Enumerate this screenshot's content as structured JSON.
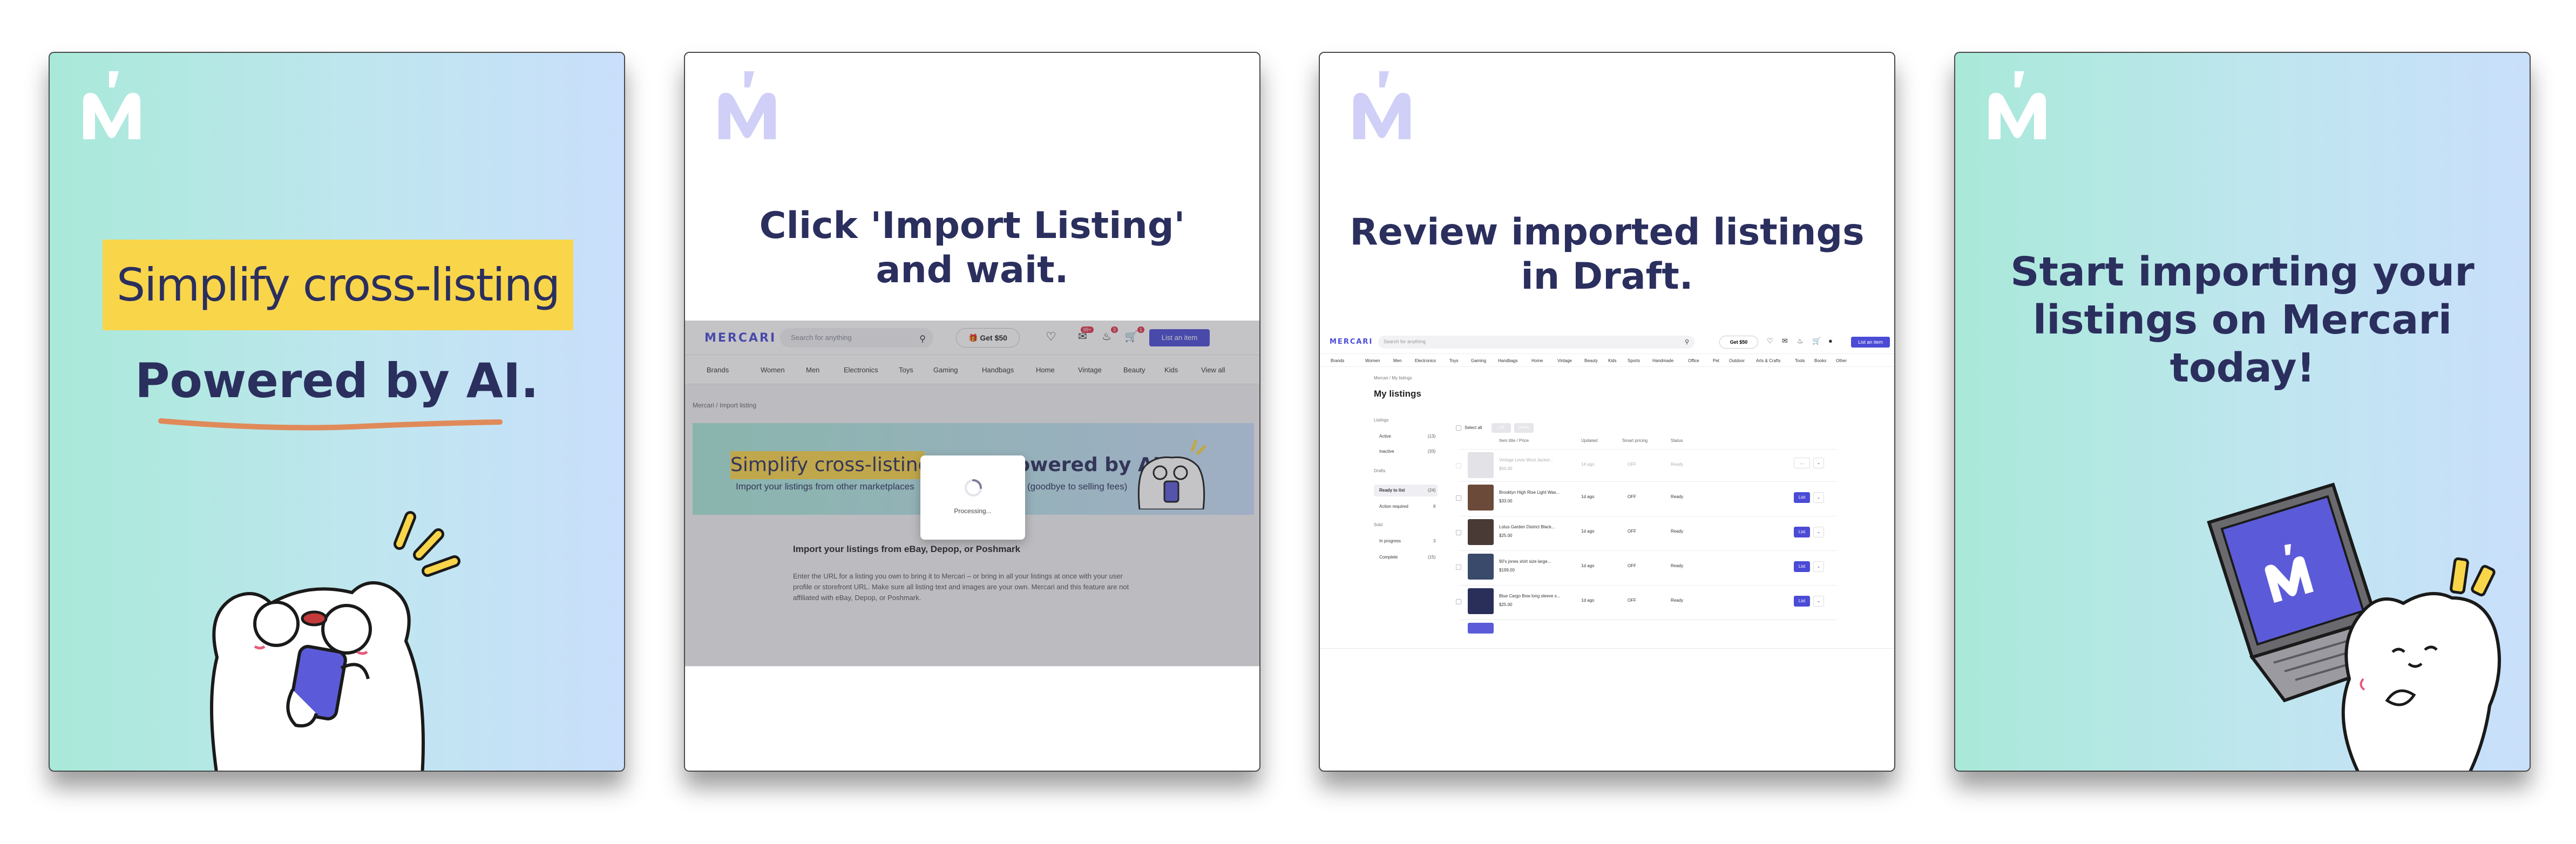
{
  "colors": {
    "brand_navy": "#2b2f5e",
    "brand_purple": "#4b4bd6",
    "highlight_yellow": "#f9d54a",
    "underline_orange": "#e08a5a",
    "mint": "#a9e9d9",
    "light_blue": "#c9dffb"
  },
  "logo": {
    "icon": "mercari-m-logo-icon"
  },
  "cards": {
    "card1": {
      "highlight": "Simplify cross-listing",
      "powered": "Powered by AI."
    },
    "card2": {
      "headline_line1": "Click 'Import Listing'",
      "headline_line2": "and wait."
    },
    "card3": {
      "headline_line1": "Review imported listings",
      "headline_line2": "in Draft."
    },
    "card4": {
      "headline_line1": "Start importing your",
      "headline_line2": "listings on Mercari",
      "headline_line3": "today!"
    }
  },
  "import_screen": {
    "logo": "MERCARI",
    "search_placeholder": "Search for anything",
    "get_label": "Get $50",
    "badge_messages": "99+",
    "badge_notifications": "3",
    "badge_cart": "1",
    "list_button": "List an item",
    "categories": [
      "Brands",
      "Women",
      "Men",
      "Electronics",
      "Toys",
      "Gaming",
      "Handbags",
      "Home",
      "Vintage",
      "Beauty",
      "Kids",
      "View all"
    ],
    "breadcrumb": "Mercari / Import listing",
    "banner_highlight": "Simplify cross-listing",
    "banner_powered": "Powered by AI.",
    "banner_sub_left": "Import your listings from other marketplaces",
    "banner_sub_right": "(goodbye to selling fees)",
    "title": "Import your listings from eBay, Depop, or Poshmark",
    "body": "Enter the URL for a listing you own to bring it to Mercari – or bring in all your listings at once with your user profile or storefront URL. Make sure all listing text and images are your own. Mercari and this feature are not affiliated with eBay, Depop, or Poshmark.",
    "processing": "Processing..."
  },
  "drafts_screen": {
    "logo": "MERCARI",
    "search_placeholder": "Search for anything",
    "get_label": "Get $50",
    "list_button": "List an item",
    "categories": [
      "Brands",
      "Women",
      "Men",
      "Electronics",
      "Toys",
      "Gaming",
      "Handbags",
      "Home",
      "Vintage",
      "Beauty",
      "Kids",
      "Sports",
      "Handmade",
      "Office",
      "Pet",
      "Outdoor",
      "Arts & Crafts",
      "Tools",
      "Books",
      "Other"
    ],
    "breadcrumb": "Mercari / My listings",
    "title": "My listings",
    "sidebar": {
      "listings_label": "Listings",
      "active": "Active",
      "active_count": "(13)",
      "inactive": "Inactive",
      "inactive_count": "(33)",
      "drafts_label": "Drafts",
      "ready": "Ready to list",
      "ready_count": "(24)",
      "action": "Action required",
      "action_count": "8",
      "sold_label": "Sold",
      "in_progress": "In progress",
      "in_progress_count": "3",
      "complete": "Complete",
      "complete_count": "(15)"
    },
    "select_all": "Select all",
    "btn_list": "List",
    "btn_delete": "Delete",
    "columns": [
      "Item title / Price",
      "Updated",
      "Smart pricing",
      "Status"
    ],
    "rows": [
      {
        "title": "Vintage Levis Wool Jacket...",
        "price": "$50.00",
        "updated": "14 ago",
        "pricing": "OFF",
        "status": "Ready",
        "action": ""
      },
      {
        "title": "Brooklyn High Rise Light Was...",
        "price": "$33.00",
        "updated": "1d ago",
        "pricing": "OFF",
        "status": "Ready",
        "action": "List"
      },
      {
        "title": "Lotus Garden District Black...",
        "price": "$25.00",
        "updated": "1d ago",
        "pricing": "OFF",
        "status": "Ready",
        "action": "List"
      },
      {
        "title": "90's jones shirt size large...",
        "price": "$199.00",
        "updated": "1d ago",
        "pricing": "OFF",
        "status": "Ready",
        "action": "List"
      },
      {
        "title": "Blue Cargo Bow long sleeve s...",
        "price": "$25.00",
        "updated": "1d ago",
        "pricing": "OFF",
        "status": "Ready",
        "action": "List"
      }
    ]
  },
  "icons": {
    "bear_phone": "bear-with-phone-icon",
    "bear_laptop": "bear-with-laptop-icon",
    "spinner": "loading-spinner-icon"
  }
}
